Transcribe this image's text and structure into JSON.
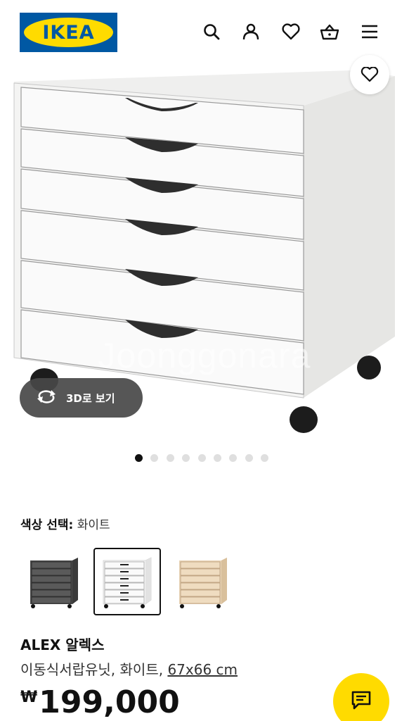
{
  "header": {
    "logo_text": "IKEA",
    "icons": [
      "search-icon",
      "user-icon",
      "heart-icon",
      "basket-icon",
      "menu-icon"
    ]
  },
  "gallery": {
    "watermark": "Joonggonara",
    "view_3d_label": "3D로 보기",
    "image_count": 9,
    "active_index": 0
  },
  "color_selection": {
    "label": "색상 선택:",
    "value": "화이트",
    "options": [
      "dark-grey",
      "white",
      "oak"
    ],
    "selected": "white"
  },
  "product": {
    "name": "ALEX 알렉스",
    "description": "이동식서랍유닛, 화이트, ",
    "size_link": "67x66 cm",
    "currency": "₩",
    "price": "199,000"
  },
  "colors": {
    "ikea_blue": "#0058a3",
    "ikea_yellow": "#ffdb00"
  }
}
